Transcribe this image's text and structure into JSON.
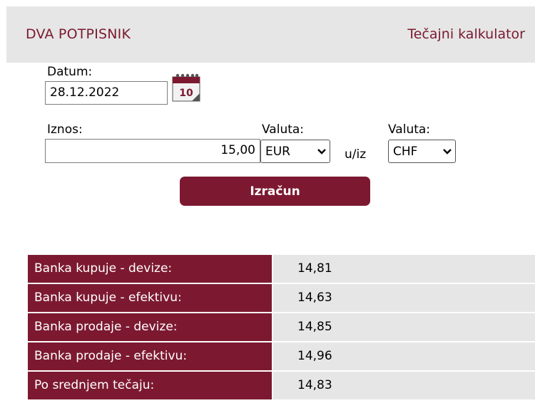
{
  "header": {
    "left_title": "DVA POTPISNIK",
    "right_title": "Tečajni kalkulator"
  },
  "form": {
    "date_label": "Datum:",
    "date_value": "28.12.2022",
    "calendar_day": "10",
    "amount_label": "Iznos:",
    "amount_value": "15,00",
    "currency_from_label": "Valuta:",
    "currency_from_value": "EUR",
    "direction_text": "u/iz",
    "currency_to_label": "Valuta:",
    "currency_to_value": "CHF",
    "calculate_button": "Izračun"
  },
  "rates": [
    {
      "label": "Banka kupuje - devize:",
      "value": "14,81"
    },
    {
      "label": "Banka kupuje - efektivu:",
      "value": "14,63"
    },
    {
      "label": "Banka prodaje - devize:",
      "value": "14,85"
    },
    {
      "label": "Banka prodaje - efektivu:",
      "value": "14,96"
    },
    {
      "label": "Po srednjem tečaju:",
      "value": "14,83"
    }
  ],
  "colors": {
    "brand": "#7c1930",
    "header_bg": "#e6e6e6",
    "header_text": "#7a1a2e"
  },
  "icons": {
    "calendar": "calendar-icon",
    "dropdown": "chevron-down-icon"
  }
}
